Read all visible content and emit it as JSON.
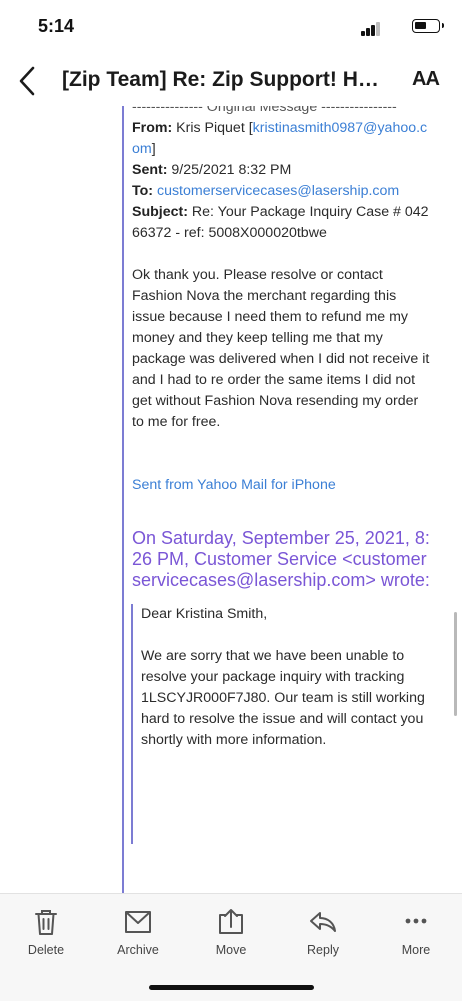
{
  "status_bar": {
    "time": "5:14"
  },
  "nav": {
    "title": "[Zip Team] Re: Zip Support! Ho...",
    "text_size_label": "AA"
  },
  "message": {
    "separator": "--------------- Original Message ----------------",
    "from_label": "From:",
    "from_name": "Kris Piquet [",
    "from_email": "kristinasmith0987@yahoo.com",
    "from_close": "]",
    "sent_label": "Sent:",
    "sent_value": "9/25/2021 8:32 PM",
    "to_label": "To:",
    "to_email": "customerservicecases@lasership.com",
    "subject_label": "Subject:",
    "subject_value": "Re: Your Package Inquiry Case # 04266372 - ref: 5008X000020tbwe",
    "body": "Ok thank you. Please resolve or contact Fashion Nova the merchant regarding this issue because I need them to refund me my money and they keep telling me that my package was delivered when I did not receive it and I had to re order the same items I did not get without Fashion Nova resending my order to me for free.",
    "signature": "Sent from Yahoo Mail for iPhone",
    "wrote_line": "On Saturday, September 25, 2021, 8:26 PM, Customer Service <customerservicecases@lasership.com> wrote:",
    "reply_greeting": "Dear Kristina Smith,",
    "reply_body": "We are sorry that we have been unable to resolve your package inquiry with tracking 1LSCYJR000F7J80. Our team is still working hard to resolve the issue and will contact you shortly with more information."
  },
  "toolbar": {
    "delete": "Delete",
    "archive": "Archive",
    "move": "Move",
    "reply": "Reply",
    "more": "More"
  },
  "colors": {
    "link": "#3b7fd5",
    "quote": "#7a56d6",
    "quote_bar": "#7c7cd3"
  }
}
